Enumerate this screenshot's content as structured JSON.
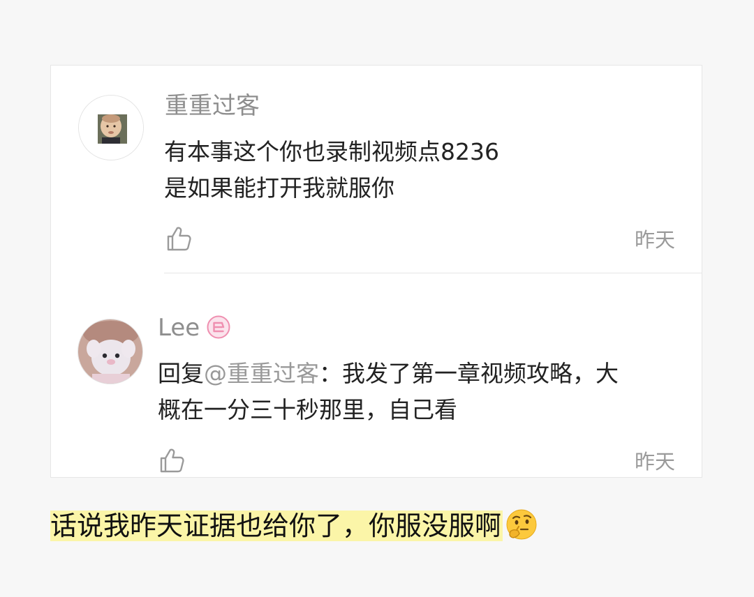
{
  "comments": [
    {
      "username": "重重过客",
      "lines": [
        "有本事这个你也录制视频点8236",
        "是如果能打开我就服你"
      ],
      "time": "昨天"
    },
    {
      "username": "Lee",
      "reply_prefix": "回复",
      "mention": "@重重过客",
      "reply_text_line1": "：我发了第一章视频攻略，大",
      "reply_text_line2": "概在一分三十秒那里，自己看",
      "time": "昨天"
    }
  ],
  "caption": {
    "text": "话说我昨天证据也给你了，你服没服啊",
    "highlight_color": "#fbf5a8"
  },
  "icons": {
    "like": "thumbs-up-icon",
    "badge": "vip-badge-icon",
    "emoji": "thinking-face-emoji"
  },
  "colors": {
    "username": "#8e8e8e",
    "mention": "#999999",
    "time": "#9a9a9a",
    "badge": "#ef8fb0"
  }
}
